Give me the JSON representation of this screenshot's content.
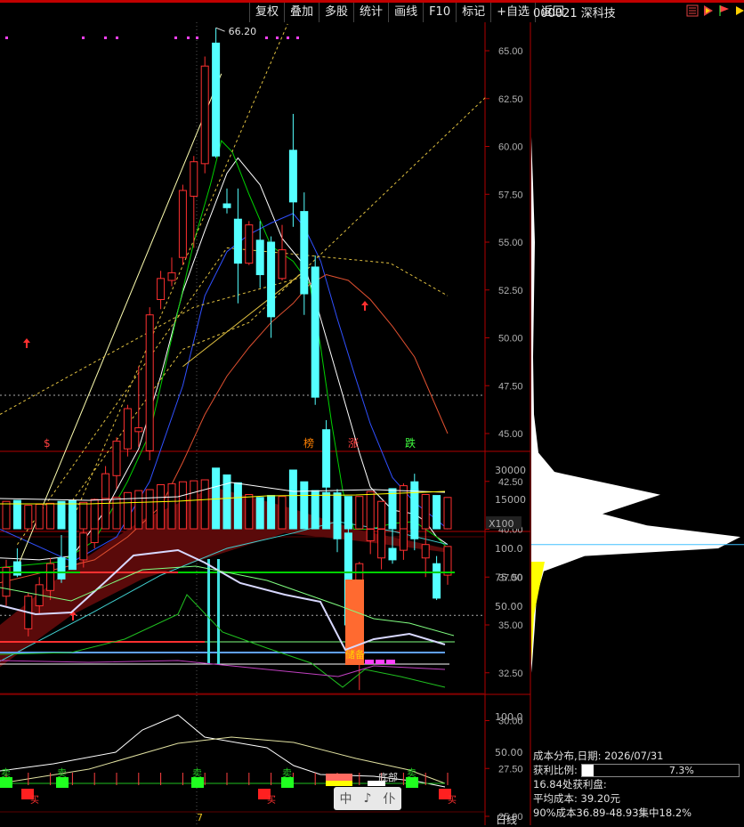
{
  "toolbar": {
    "buttons": [
      "复权",
      "叠加",
      "多股",
      "统计",
      "画线",
      "F10",
      "标记",
      "+自选",
      "返回"
    ]
  },
  "stock": {
    "code": "000021",
    "name": "深科技",
    "title": "000021 深科技"
  },
  "main_axis": {
    "ticks": [
      "65.00",
      "62.50",
      "60.00",
      "57.50",
      "55.00",
      "52.50",
      "50.00",
      "47.50",
      "45.00",
      "42.50",
      "40.00",
      "37.50",
      "35.00",
      "32.50",
      "30.00",
      "27.50",
      "25.00"
    ],
    "high_label": "66.20",
    "markers": [
      {
        "text": "$",
        "color": "#ff4040"
      },
      {
        "text": "榜",
        "color": "#ff8000"
      },
      {
        "text": "涨",
        "color": "#ff4040"
      },
      {
        "text": "跌",
        "color": "#40ff40"
      }
    ]
  },
  "volume_axis": {
    "ticks": [
      "30000",
      "15000"
    ],
    "unit": "X100"
  },
  "ind1_axis": {
    "ticks": [
      "100.0",
      "75.00",
      "50.00"
    ],
    "label": "储备"
  },
  "ind2_axis": {
    "ticks": [
      "100.0",
      "50.00"
    ],
    "labels": {
      "sell": "卖",
      "buy": "买",
      "bottom": "底部"
    }
  },
  "bottom": {
    "period": "日线",
    "date_tick": "7"
  },
  "cost": {
    "date_line": "成本分布,日期: 2026/07/31",
    "profit_label": "获利比例:",
    "profit_value": "7.3%",
    "profit_fraction": 0.073,
    "profit_at": "16.84处获利盘:",
    "avg_cost": "平均成本: 39.20元",
    "concentration": "90%成本36.89-48.93集中18.2%"
  },
  "fake_buttons": [
    "中",
    "♪",
    "仆"
  ],
  "colors": {
    "up": "#ff3030",
    "down": "#54ffff",
    "grid": "#7a0000",
    "axis": "#b00000",
    "ma_white": "#ffffff",
    "ma_yellow": "#ffff00",
    "ma_green": "#00c000",
    "ma_blue": "#2040ff",
    "ma_red": "#c04020"
  },
  "candles": [
    {
      "o": 36.5,
      "h": 38.4,
      "l": 36.0,
      "c": 38.0
    },
    {
      "o": 38.3,
      "h": 39.0,
      "l": 37.5,
      "c": 37.6
    },
    {
      "o": 34.8,
      "h": 36.7,
      "l": 34.4,
      "c": 36.5
    },
    {
      "o": 36.0,
      "h": 37.5,
      "l": 35.6,
      "c": 37.1
    },
    {
      "o": 36.8,
      "h": 38.5,
      "l": 36.3,
      "c": 38.2
    },
    {
      "o": 38.5,
      "h": 39.7,
      "l": 37.2,
      "c": 37.4
    },
    {
      "o": 40.8,
      "h": 40.9,
      "l": 37.9,
      "c": 37.9
    },
    {
      "o": 38.4,
      "h": 40.2,
      "l": 38.0,
      "c": 39.8
    },
    {
      "o": 39.3,
      "h": 41.6,
      "l": 39.0,
      "c": 41.1
    },
    {
      "o": 40.7,
      "h": 43.3,
      "l": 40.0,
      "c": 42.9
    },
    {
      "o": 42.8,
      "h": 44.8,
      "l": 42.1,
      "c": 44.6
    },
    {
      "o": 44.2,
      "h": 46.5,
      "l": 43.8,
      "c": 46.3
    },
    {
      "o": 45.1,
      "h": 48.5,
      "l": 44.3,
      "c": 45.3
    },
    {
      "o": 44.1,
      "h": 51.6,
      "l": 43.6,
      "c": 51.2
    },
    {
      "o": 52.0,
      "h": 53.5,
      "l": 51.5,
      "c": 53.1
    },
    {
      "o": 53.0,
      "h": 54.2,
      "l": 52.7,
      "c": 53.4
    },
    {
      "o": 54.2,
      "h": 58.0,
      "l": 53.8,
      "c": 57.7
    },
    {
      "o": 57.4,
      "h": 59.5,
      "l": 54.7,
      "c": 59.2
    },
    {
      "o": 59.1,
      "h": 64.7,
      "l": 58.6,
      "c": 64.2
    },
    {
      "o": 65.4,
      "h": 66.2,
      "l": 59.4,
      "c": 59.5
    },
    {
      "o": 57.0,
      "h": 57.8,
      "l": 56.5,
      "c": 56.8
    },
    {
      "o": 56.2,
      "h": 57.8,
      "l": 51.8,
      "c": 53.9
    },
    {
      "o": 53.9,
      "h": 56.1,
      "l": 53.8,
      "c": 55.9
    },
    {
      "o": 55.1,
      "h": 56.1,
      "l": 52.6,
      "c": 53.3
    },
    {
      "o": 55.0,
      "h": 55.3,
      "l": 50.0,
      "c": 51.1
    },
    {
      "o": 53.1,
      "h": 55.9,
      "l": 53.0,
      "c": 54.6
    },
    {
      "o": 59.8,
      "h": 61.7,
      "l": 55.8,
      "c": 57.1
    },
    {
      "o": 56.6,
      "h": 57.6,
      "l": 51.2,
      "c": 52.3
    },
    {
      "o": 53.7,
      "h": 54.3,
      "l": 46.5,
      "c": 46.9
    },
    {
      "o": 45.2,
      "h": 45.7,
      "l": 41.5,
      "c": 42.2
    },
    {
      "o": 41.9,
      "h": 42.1,
      "l": 38.8,
      "c": 39.5
    },
    {
      "o": 39.8,
      "h": 40.1,
      "l": 34.3,
      "c": 35.0
    },
    {
      "o": 34.9,
      "h": 38.3,
      "l": 31.6,
      "c": 38.2
    },
    {
      "o": 39.4,
      "h": 40.5,
      "l": 38.7,
      "c": 40.0
    },
    {
      "o": 38.5,
      "h": 40.9,
      "l": 37.9,
      "c": 40.0
    },
    {
      "o": 39.0,
      "h": 40.5,
      "l": 38.2,
      "c": 38.4
    },
    {
      "o": 38.9,
      "h": 42.4,
      "l": 38.4,
      "c": 41.8
    },
    {
      "o": 42.1,
      "h": 42.9,
      "l": 38.9,
      "c": 39.5
    },
    {
      "o": 38.5,
      "h": 41.0,
      "l": 37.5,
      "c": 39.2
    },
    {
      "o": 38.2,
      "h": 38.6,
      "l": 36.3,
      "c": 36.4
    },
    {
      "o": 37.6,
      "h": 38.9,
      "l": 37.1,
      "c": 39.1
    }
  ],
  "volumes": [
    14000,
    14500,
    12000,
    12500,
    13000,
    14000,
    14500,
    13500,
    15000,
    15500,
    16000,
    18500,
    19500,
    20000,
    22500,
    23000,
    24000,
    24500,
    25000,
    31000,
    27500,
    23500,
    17500,
    16000,
    17000,
    16500,
    30000,
    24000,
    19500,
    18500,
    17500,
    16500,
    16500,
    19000,
    14000,
    20500,
    22000,
    24000,
    17500,
    17000,
    16000
  ]
}
